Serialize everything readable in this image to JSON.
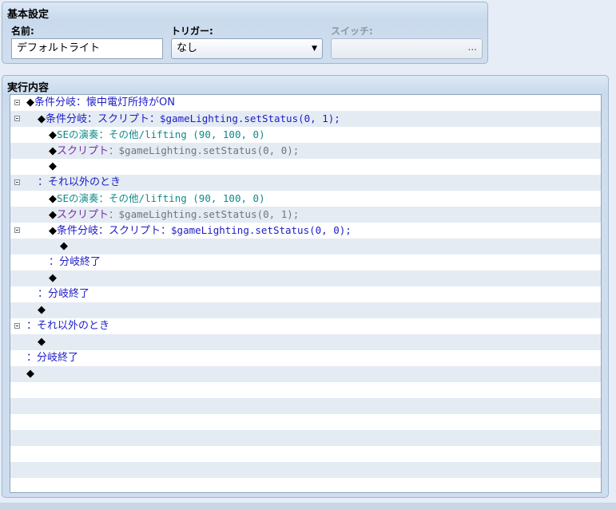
{
  "basic_settings": {
    "title": "基本設定",
    "name_label": "名前:",
    "name_value": "デフォルトライト",
    "trigger_label": "トリガー:",
    "trigger_value": "なし",
    "switch_label": "スイッチ:",
    "switch_value": "",
    "switch_button": "..."
  },
  "contents": {
    "title": "実行内容",
    "rows": [
      {
        "indent": 0,
        "collapse": true,
        "parts": [
          {
            "t": "◆",
            "c": "black"
          },
          {
            "t": "条件分岐：懐中電灯所持がON",
            "c": "blue"
          }
        ]
      },
      {
        "indent": 1,
        "collapse": true,
        "parts": [
          {
            "t": "◆",
            "c": "black"
          },
          {
            "t": "条件分岐：スクリプト：",
            "c": "blue"
          },
          {
            "t": "$gameLighting.setStatus(0, 1);",
            "c": "blue",
            "mono": true
          }
        ]
      },
      {
        "indent": 2,
        "collapse": false,
        "parts": [
          {
            "t": "◆",
            "c": "black"
          },
          {
            "t": "SEの演奏：その他/lifting (90, 100, 0)",
            "c": "teal",
            "mono": true
          }
        ]
      },
      {
        "indent": 2,
        "collapse": false,
        "parts": [
          {
            "t": "◆",
            "c": "black"
          },
          {
            "t": "スクリプト",
            "c": "purple"
          },
          {
            "t": "：$gameLighting.setStatus(0, 0);",
            "c": "gray",
            "mono": true
          }
        ]
      },
      {
        "indent": 2,
        "collapse": false,
        "parts": [
          {
            "t": "◆",
            "c": "black"
          }
        ]
      },
      {
        "indent": 1,
        "collapse": true,
        "parts": [
          {
            "t": "：それ以外のとき",
            "c": "blue"
          }
        ]
      },
      {
        "indent": 2,
        "collapse": false,
        "parts": [
          {
            "t": "◆",
            "c": "black"
          },
          {
            "t": "SEの演奏：その他/lifting (90, 100, 0)",
            "c": "teal",
            "mono": true
          }
        ]
      },
      {
        "indent": 2,
        "collapse": false,
        "parts": [
          {
            "t": "◆",
            "c": "black"
          },
          {
            "t": "スクリプト",
            "c": "purple"
          },
          {
            "t": "：$gameLighting.setStatus(0, 1);",
            "c": "gray",
            "mono": true
          }
        ]
      },
      {
        "indent": 2,
        "collapse": true,
        "parts": [
          {
            "t": "◆",
            "c": "black"
          },
          {
            "t": "条件分岐：スクリプト：",
            "c": "blue"
          },
          {
            "t": "$gameLighting.setStatus(0, 0);",
            "c": "blue",
            "mono": true
          }
        ]
      },
      {
        "indent": 3,
        "collapse": false,
        "parts": [
          {
            "t": "◆",
            "c": "black"
          }
        ]
      },
      {
        "indent": 2,
        "collapse": false,
        "parts": [
          {
            "t": "：分岐終了",
            "c": "blue"
          }
        ]
      },
      {
        "indent": 2,
        "collapse": false,
        "parts": [
          {
            "t": "◆",
            "c": "black"
          }
        ]
      },
      {
        "indent": 1,
        "collapse": false,
        "parts": [
          {
            "t": "：分岐終了",
            "c": "blue"
          }
        ]
      },
      {
        "indent": 1,
        "collapse": false,
        "parts": [
          {
            "t": "◆",
            "c": "black"
          }
        ]
      },
      {
        "indent": 0,
        "collapse": true,
        "parts": [
          {
            "t": "：それ以外のとき",
            "c": "blue"
          }
        ]
      },
      {
        "indent": 1,
        "collapse": false,
        "parts": [
          {
            "t": "◆",
            "c": "black"
          }
        ]
      },
      {
        "indent": 0,
        "collapse": false,
        "parts": [
          {
            "t": "：分岐終了",
            "c": "blue"
          }
        ]
      },
      {
        "indent": 0,
        "collapse": false,
        "parts": [
          {
            "t": "◆",
            "c": "black"
          }
        ]
      },
      {
        "indent": 0,
        "collapse": false,
        "parts": []
      },
      {
        "indent": 0,
        "collapse": false,
        "parts": []
      },
      {
        "indent": 0,
        "collapse": false,
        "parts": []
      },
      {
        "indent": 0,
        "collapse": false,
        "parts": []
      },
      {
        "indent": 0,
        "collapse": false,
        "parts": []
      },
      {
        "indent": 0,
        "collapse": false,
        "parts": []
      },
      {
        "indent": 0,
        "collapse": false,
        "parts": []
      }
    ]
  }
}
